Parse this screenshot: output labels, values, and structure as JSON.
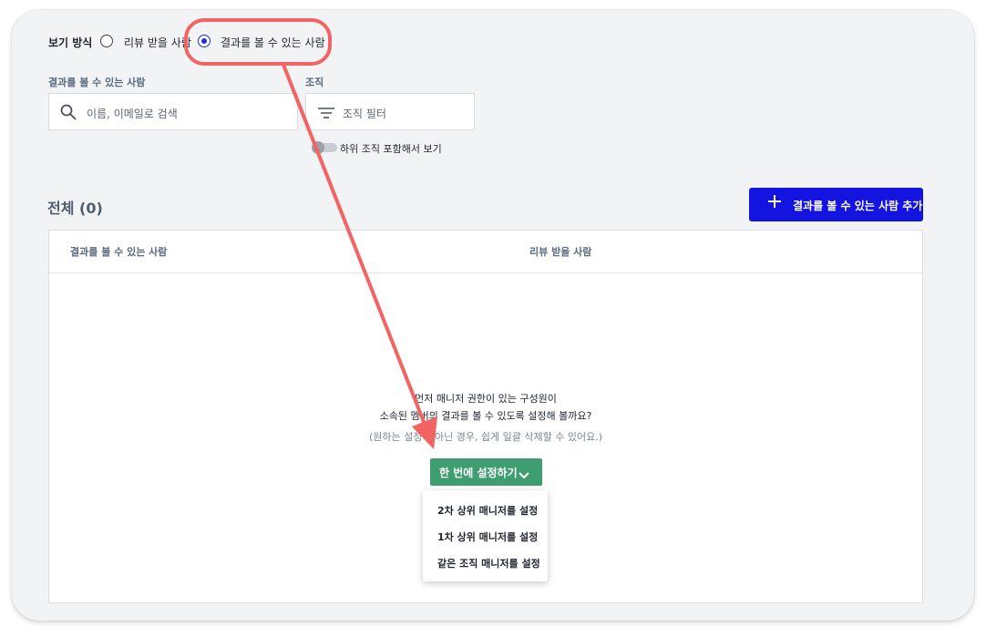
{
  "view_mode": {
    "label": "보기 방식",
    "options": [
      {
        "label": "리뷰 받을 사람",
        "selected": false
      },
      {
        "label": "결과를 볼 수 있는 사람",
        "selected": true
      }
    ]
  },
  "filters": {
    "people_label": "결과를 볼 수 있는 사람",
    "search_placeholder": "이름, 이메일로 검색",
    "org_label": "조직",
    "org_filter_text": "조직 필터",
    "include_sub_orgs_label": "하위 조직 포함해서 보기"
  },
  "list": {
    "total_label": "전체 (0)",
    "add_button_label": "결과를 볼 수 있는 사람 추가",
    "columns": [
      "결과를 볼 수 있는 사람",
      "리뷰 받을 사람"
    ]
  },
  "empty_state": {
    "line1": "먼저 매니저 권한이 있는 구성원이",
    "line2": "소속된 멤버의 결과를 볼 수 있도록 설정해 볼까요?",
    "hint": "(원하는 설정이 아닌 경우, 쉽게 일괄 삭제할 수 있어요.)",
    "bulk_button_label": "한 번에 설정하기"
  },
  "dropdown_menu": {
    "items": [
      "2차 상위 매니저를 설정",
      "1차 상위 매니저를 설정",
      "같은 조직 매니저를 설정"
    ]
  },
  "colors": {
    "primary": "#1414e0",
    "success": "#3e9e70",
    "annotation": "#f26464"
  },
  "icons": [
    "search-icon",
    "filter-icon",
    "plus-icon",
    "chevron-down-icon"
  ]
}
